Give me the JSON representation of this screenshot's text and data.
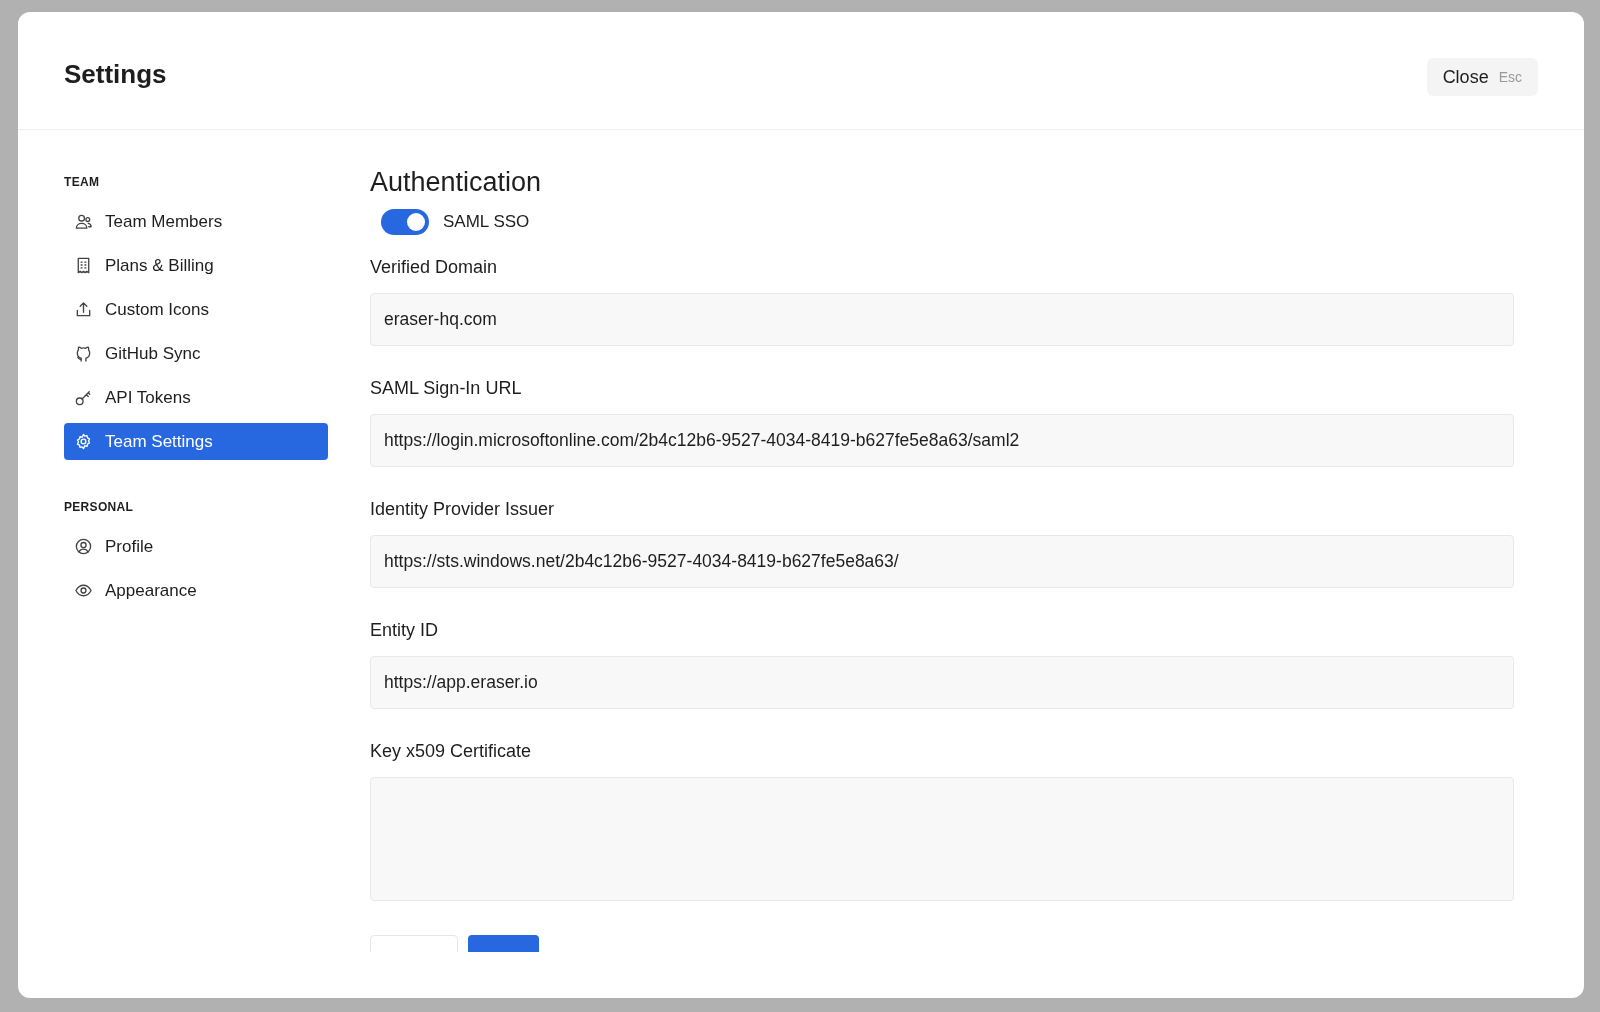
{
  "dialog": {
    "title": "Settings",
    "close_button": {
      "label": "Close",
      "shortcut": "Esc"
    }
  },
  "sidebar": {
    "sections": [
      {
        "heading": "TEAM",
        "items": [
          {
            "label": "Team Members",
            "selected": false
          },
          {
            "label": "Plans & Billing",
            "selected": false
          },
          {
            "label": "Custom Icons",
            "selected": false
          },
          {
            "label": "GitHub Sync",
            "selected": false
          },
          {
            "label": "API Tokens",
            "selected": false
          },
          {
            "label": "Team Settings",
            "selected": true
          }
        ]
      },
      {
        "heading": "PERSONAL",
        "items": [
          {
            "label": "Profile",
            "selected": false
          },
          {
            "label": "Appearance",
            "selected": false
          }
        ]
      }
    ]
  },
  "content": {
    "heading": "Authentication",
    "toggle": {
      "label": "SAML SSO",
      "on": true
    },
    "fields": [
      {
        "label": "Verified Domain",
        "value": "eraser-hq.com",
        "kind": "input"
      },
      {
        "label": "SAML Sign-In URL",
        "value": "https://login.microsoftonline.com/2b4c12b6-9527-4034-8419-b627fe5e8a63/saml2",
        "kind": "input"
      },
      {
        "label": "Identity Provider Issuer",
        "value": "https://sts.windows.net/2b4c12b6-9527-4034-8419-b627fe5e8a63/",
        "kind": "input"
      },
      {
        "label": "Entity ID",
        "value": "https://app.eraser.io",
        "kind": "input"
      },
      {
        "label": "Key x509 Certificate",
        "kind": "textarea"
      }
    ]
  }
}
